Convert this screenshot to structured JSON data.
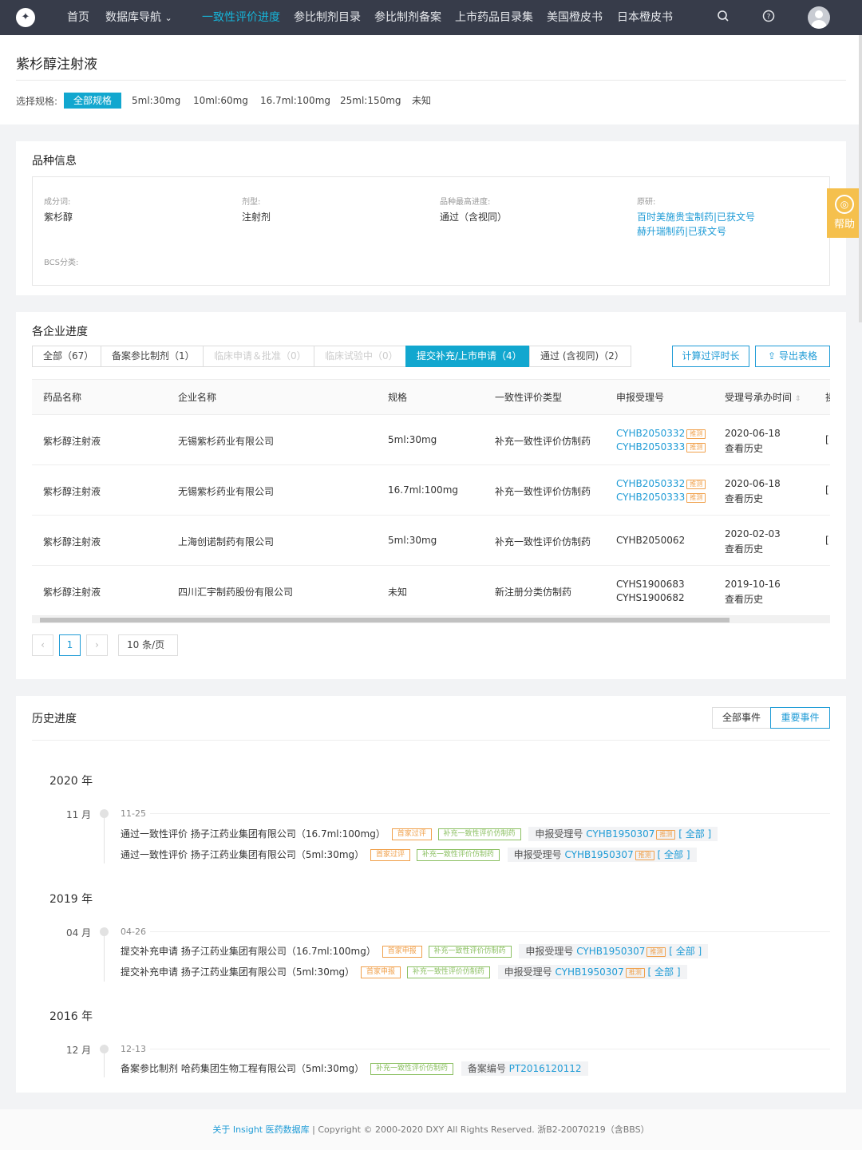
{
  "nav": {
    "logo": "✦",
    "items": [
      "首页",
      "数据库导航",
      "一致性评价进度",
      "参比制剂目录",
      "参比制剂备案",
      "上市药品目录集",
      "美国橙皮书",
      "日本橙皮书"
    ],
    "dropdown_caret": "⌄"
  },
  "page": {
    "title": "紫杉醇注射液",
    "spec_label": "选择规格:",
    "specs": [
      "全部规格",
      "5ml:30mg",
      "10ml:60mg",
      "16.7ml:100mg",
      "25ml:150mg",
      "未知"
    ]
  },
  "variety": {
    "title": "品种信息",
    "ingredient_label": "成分词:",
    "ingredient": "紫杉醇",
    "form_label": "剂型:",
    "form": "注射剂",
    "progress_label": "品种最高进度:",
    "progress": "通过（含视同）",
    "original_label": "原研:",
    "originals": [
      "百时美施贵宝制药|已获文号",
      "赫升瑞制药|已获文号"
    ],
    "bcs_label": "BCS分类:"
  },
  "help": {
    "label": "帮助"
  },
  "progress": {
    "title": "各企业进度",
    "tabs": [
      "全部（67）",
      "备案参比制剂（1）",
      "临床申请＆批准（0）",
      "临床试验中（0）",
      "提交补充/上市申请（4）",
      "通过 (含视同)（2）"
    ],
    "calc_button": "计算过评时长",
    "export_button": "导出表格",
    "columns": [
      "药品名称",
      "企业名称",
      "规格",
      "一致性评价类型",
      "申报受理号",
      "受理号承办时间",
      "操"
    ],
    "est_tag": "推测",
    "history_link": "查看历史",
    "rows": [
      {
        "drug": "紫杉醇注射液",
        "company": "无锡紫杉药业有限公司",
        "spec": "5ml:30mg",
        "type": "补充一致性评价仿制药",
        "numbers": [
          "CYHB2050332",
          "CYHB2050333"
        ],
        "date": "2020-06-18"
      },
      {
        "drug": "紫杉醇注射液",
        "company": "无锡紫杉药业有限公司",
        "spec": "16.7ml:100mg",
        "type": "补充一致性评价仿制药",
        "numbers": [
          "CYHB2050332",
          "CYHB2050333"
        ],
        "date": "2020-06-18"
      },
      {
        "drug": "紫杉醇注射液",
        "company": "上海创诺制药有限公司",
        "spec": "5ml:30mg",
        "type": "补充一致性评价仿制药",
        "numbers": [
          "CYHB2050062"
        ],
        "date": "2020-02-03"
      },
      {
        "drug": "紫杉醇注射液",
        "company": "四川汇宇制药股份有限公司",
        "spec": "未知",
        "type": "新注册分类仿制药",
        "numbers": [
          "CYHS1900683",
          "CYHS1900682"
        ],
        "date": "2019-10-16"
      }
    ],
    "pagination": {
      "prev": "‹",
      "page": "1",
      "next": "›",
      "size": "10 条/页"
    }
  },
  "history": {
    "title": "历史进度",
    "all_events": "全部事件",
    "key_events": "重要事件",
    "years": [
      {
        "year": "2020 年",
        "month": "11 月",
        "date": "11-25",
        "events": [
          {
            "action": "通过一致性评价",
            "company": "扬子江药业集团有限公司",
            "spec": "（16.7ml:100mg）",
            "tags": [
              "首家过评",
              "补充一致性评价仿制药"
            ],
            "label": "申报受理号",
            "number": "CYHB1950307",
            "est": "推测",
            "all": "[ 全部 ]"
          },
          {
            "action": "通过一致性评价",
            "company": "扬子江药业集团有限公司",
            "spec": "（5ml:30mg）",
            "tags": [
              "首家过评",
              "补充一致性评价仿制药"
            ],
            "label": "申报受理号",
            "number": "CYHB1950307",
            "est": "推测",
            "all": "[ 全部 ]"
          }
        ]
      },
      {
        "year": "2019 年",
        "month": "04 月",
        "date": "04-26",
        "events": [
          {
            "action": "提交补充申请",
            "company": "扬子江药业集团有限公司",
            "spec": "（16.7ml:100mg）",
            "tags": [
              "首家申报",
              "补充一致性评价仿制药"
            ],
            "label": "申报受理号",
            "number": "CYHB1950307",
            "est": "推测",
            "all": "[ 全部 ]"
          },
          {
            "action": "提交补充申请",
            "company": "扬子江药业集团有限公司",
            "spec": "（5ml:30mg）",
            "tags": [
              "首家申报",
              "补充一致性评价仿制药"
            ],
            "label": "申报受理号",
            "number": "CYHB1950307",
            "est": "推测",
            "all": "[ 全部 ]"
          }
        ]
      },
      {
        "year": "2016 年",
        "month": "12 月",
        "date": "12-13",
        "events": [
          {
            "action": "备案参比制剂",
            "company": "哈药集团生物工程有限公司",
            "spec": "（5ml:30mg）",
            "tags": [
              "补充一致性评价仿制药"
            ],
            "label": "备案编号",
            "number": "PT2016120112"
          }
        ]
      }
    ]
  },
  "footer": {
    "about": "关于 Insight 医药数据库",
    "sep": " | ",
    "copyright": "Copyright © 2000-2020 DXY All Rights Reserved. 浙B2-20070219（含BBS）"
  },
  "colors": {
    "nav_bg": "#373c4a",
    "accent": "#12a7cf",
    "link": "#1e9bd6",
    "tag_orange": "#f0a04b",
    "tag_green": "#8cc063",
    "help": "#f5c04d"
  },
  "icons": [
    "logo-icon",
    "search-icon",
    "help-circle-icon",
    "avatar",
    "upload-icon",
    "sort-icon",
    "help-chat-icon"
  ]
}
